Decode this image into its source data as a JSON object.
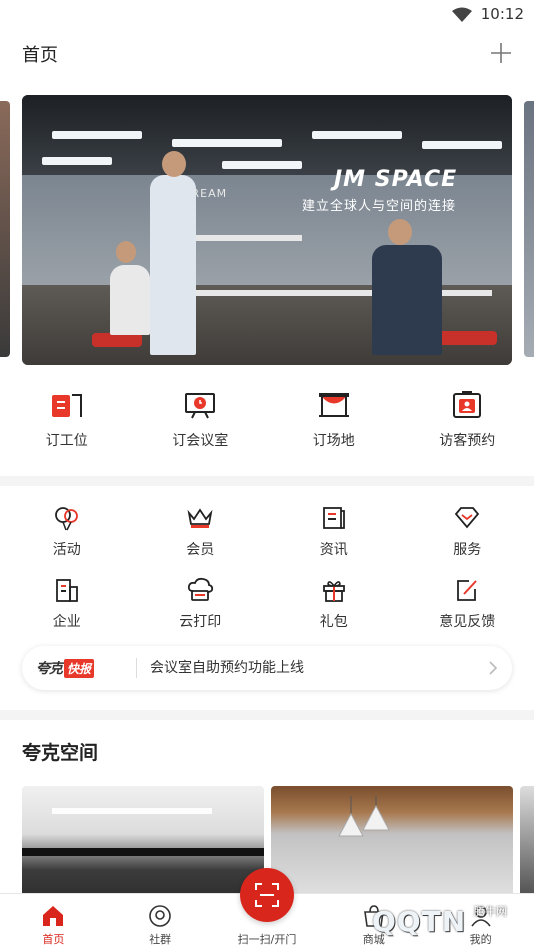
{
  "status_bar": {
    "time": "10:12"
  },
  "header": {
    "title": "首页"
  },
  "banner": {
    "brand": "JM SPACE",
    "slogan": "建立全球人与空间的连接",
    "sign_text": "DREAM"
  },
  "quick_actions": [
    {
      "label": "订工位",
      "icon": "desk-icon"
    },
    {
      "label": "订会议室",
      "icon": "meeting-room-icon"
    },
    {
      "label": "订场地",
      "icon": "venue-icon"
    },
    {
      "label": "访客预约",
      "icon": "visitor-icon"
    }
  ],
  "services": [
    {
      "label": "活动",
      "icon": "balloon-icon"
    },
    {
      "label": "会员",
      "icon": "crown-icon"
    },
    {
      "label": "资讯",
      "icon": "news-icon"
    },
    {
      "label": "服务",
      "icon": "diamond-icon"
    },
    {
      "label": "企业",
      "icon": "building-icon"
    },
    {
      "label": "云打印",
      "icon": "cloud-print-icon"
    },
    {
      "label": "礼包",
      "icon": "gift-icon"
    },
    {
      "label": "意见反馈",
      "icon": "feedback-icon"
    }
  ],
  "news": {
    "logo_main": "夸克",
    "logo_badge": "快报",
    "text": "会议室自助预约功能上线"
  },
  "section": {
    "title": "夸克空间"
  },
  "bottom_nav": [
    {
      "label": "首页",
      "icon": "home-icon",
      "active": true
    },
    {
      "label": "社群",
      "icon": "community-icon",
      "active": false
    },
    {
      "label": "扫一扫/开门",
      "icon": "scan-icon",
      "active": false
    },
    {
      "label": "商城",
      "icon": "shop-icon",
      "active": false
    },
    {
      "label": "我的",
      "icon": "profile-icon",
      "active": false
    }
  ],
  "watermark": {
    "main": "QQTN",
    "small": "腾牛网"
  },
  "colors": {
    "accent": "#d9261c",
    "text": "#333333",
    "divider": "#f4f4f4"
  }
}
